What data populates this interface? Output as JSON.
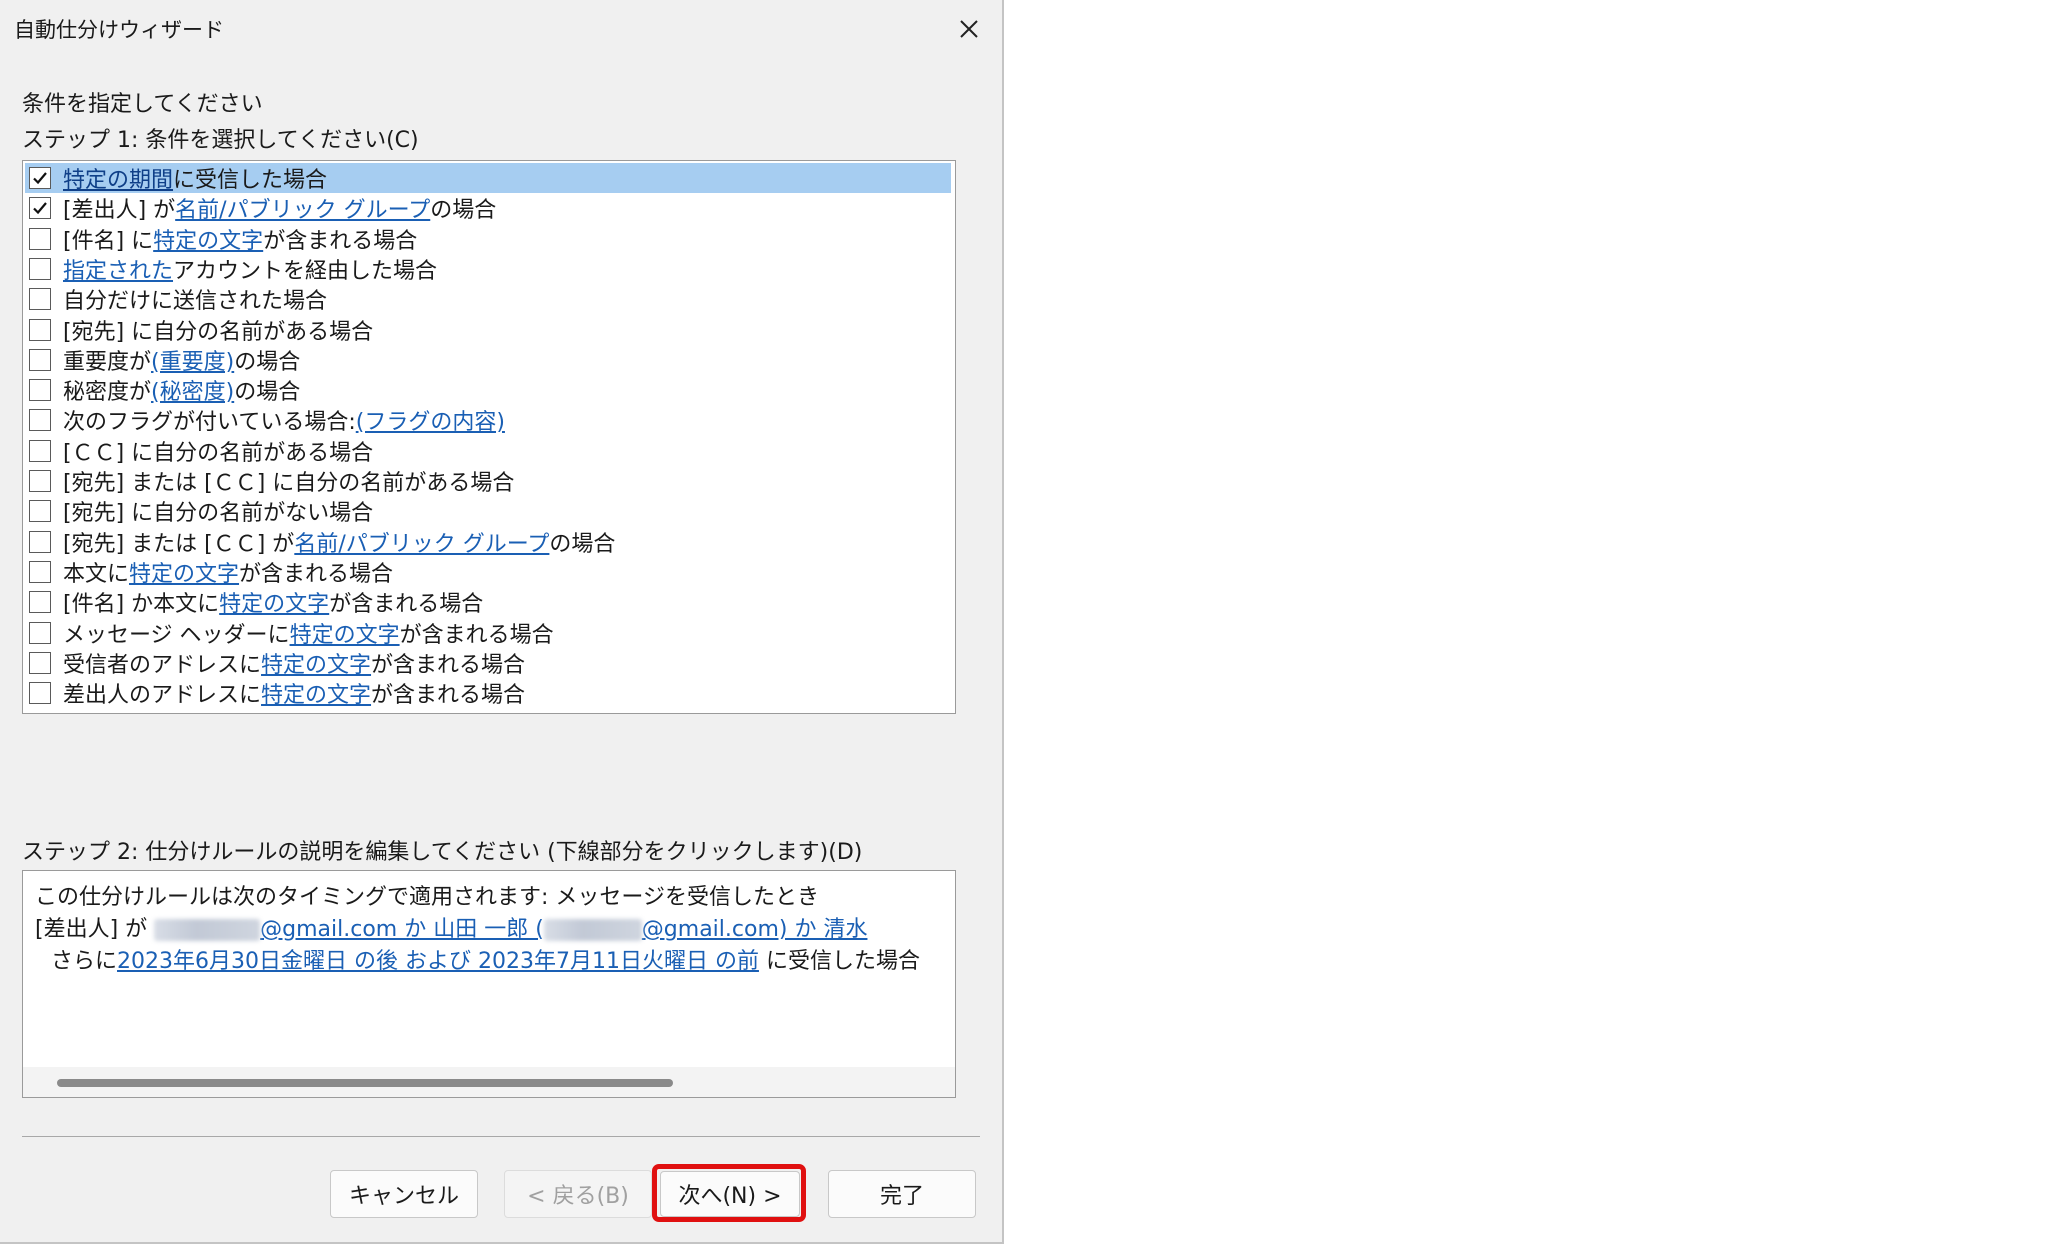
{
  "window": {
    "title": "自動仕分けウィザード",
    "close_label": "✕"
  },
  "instruction": "条件を指定してください",
  "step1": {
    "label": "ステップ 1: 条件を選択してください(C)",
    "conditions": [
      {
        "checked": true,
        "selected": true,
        "segments": [
          {
            "text": "特定の期間",
            "link": true
          },
          {
            "text": " に受信した場合",
            "link": false
          }
        ]
      },
      {
        "checked": true,
        "selected": false,
        "segments": [
          {
            "text": "[差出人] が ",
            "link": false
          },
          {
            "text": "名前/パブリック グループ",
            "link": true
          },
          {
            "text": " の場合",
            "link": false
          }
        ]
      },
      {
        "checked": false,
        "selected": false,
        "segments": [
          {
            "text": "[件名] に ",
            "link": false
          },
          {
            "text": "特定の文字",
            "link": true
          },
          {
            "text": " が含まれる場合",
            "link": false
          }
        ]
      },
      {
        "checked": false,
        "selected": false,
        "segments": [
          {
            "text": "指定された",
            "link": true
          },
          {
            "text": " アカウントを経由した場合",
            "link": false
          }
        ]
      },
      {
        "checked": false,
        "selected": false,
        "segments": [
          {
            "text": "自分だけに送信された場合",
            "link": false
          }
        ]
      },
      {
        "checked": false,
        "selected": false,
        "segments": [
          {
            "text": "[宛先] に自分の名前がある場合",
            "link": false
          }
        ]
      },
      {
        "checked": false,
        "selected": false,
        "segments": [
          {
            "text": "重要度が ",
            "link": false
          },
          {
            "text": "(重要度)",
            "link": true
          },
          {
            "text": " の場合",
            "link": false
          }
        ]
      },
      {
        "checked": false,
        "selected": false,
        "segments": [
          {
            "text": "秘密度が ",
            "link": false
          },
          {
            "text": "(秘密度)",
            "link": true
          },
          {
            "text": " の場合",
            "link": false
          }
        ]
      },
      {
        "checked": false,
        "selected": false,
        "segments": [
          {
            "text": "次のフラグが付いている場合: ",
            "link": false
          },
          {
            "text": "(フラグの内容)",
            "link": true
          }
        ]
      },
      {
        "checked": false,
        "selected": false,
        "segments": [
          {
            "text": "[ＣＣ] に自分の名前がある場合",
            "link": false
          }
        ]
      },
      {
        "checked": false,
        "selected": false,
        "segments": [
          {
            "text": "[宛先] または [ＣＣ] に自分の名前がある場合",
            "link": false
          }
        ]
      },
      {
        "checked": false,
        "selected": false,
        "segments": [
          {
            "text": "[宛先] に自分の名前がない場合",
            "link": false
          }
        ]
      },
      {
        "checked": false,
        "selected": false,
        "segments": [
          {
            "text": "[宛先] または [ＣＣ] が ",
            "link": false
          },
          {
            "text": "名前/パブリック グループ",
            "link": true
          },
          {
            "text": " の場合",
            "link": false
          }
        ]
      },
      {
        "checked": false,
        "selected": false,
        "segments": [
          {
            "text": "本文に ",
            "link": false
          },
          {
            "text": "特定の文字",
            "link": true
          },
          {
            "text": " が含まれる場合",
            "link": false
          }
        ]
      },
      {
        "checked": false,
        "selected": false,
        "segments": [
          {
            "text": "[件名] か本文に ",
            "link": false
          },
          {
            "text": "特定の文字",
            "link": true
          },
          {
            "text": " が含まれる場合",
            "link": false
          }
        ]
      },
      {
        "checked": false,
        "selected": false,
        "segments": [
          {
            "text": "メッセージ ヘッダーに ",
            "link": false
          },
          {
            "text": "特定の文字",
            "link": true
          },
          {
            "text": " が含まれる場合",
            "link": false
          }
        ]
      },
      {
        "checked": false,
        "selected": false,
        "segments": [
          {
            "text": "受信者のアドレスに ",
            "link": false
          },
          {
            "text": "特定の文字",
            "link": true
          },
          {
            "text": " が含まれる場合",
            "link": false
          }
        ]
      },
      {
        "checked": false,
        "selected": false,
        "segments": [
          {
            "text": "差出人のアドレスに ",
            "link": false
          },
          {
            "text": "特定の文字",
            "link": true
          },
          {
            "text": " が含まれる場合",
            "link": false
          }
        ]
      }
    ]
  },
  "step2": {
    "label": "ステップ 2: 仕分けルールの説明を編集してください (下線部分をクリックします)(D)",
    "line1": "この仕分けルールは次のタイミングで適用されます: メッセージを受信したとき",
    "line2_prefix": "[差出人] が ",
    "line2_link_a": "@gmail.com か 山田 一郎 (",
    "line2_link_b": "@gmail.com) か 清水",
    "line3_prefix": "さらに",
    "line3_link": "2023年6月30日金曜日 の後 および 2023年7月11日火曜日 の前",
    "line3_suffix": " に受信した場合"
  },
  "buttons": {
    "cancel": "キャンセル",
    "back": "< 戻る(B)",
    "next": "次へ(N) >",
    "finish": "完了"
  },
  "colors": {
    "highlight": "#e01010",
    "selection": "#a6cdf1",
    "link": "#1a5fb4"
  }
}
